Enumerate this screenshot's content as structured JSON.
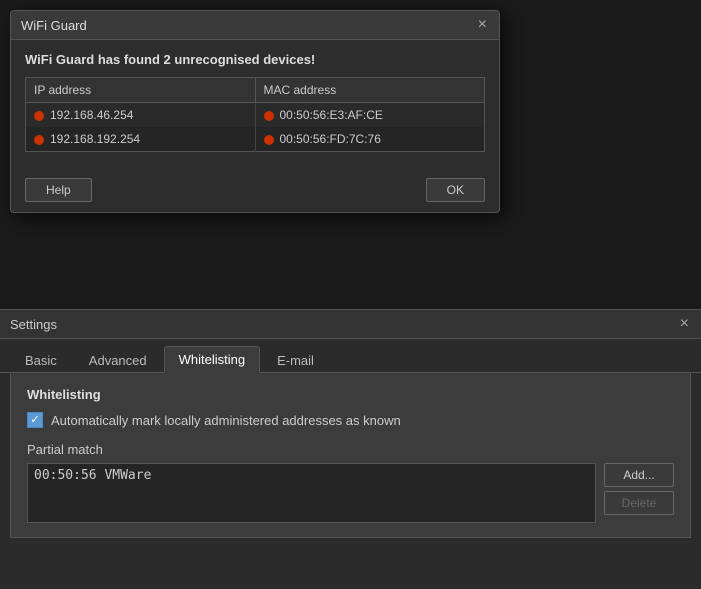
{
  "wifi_guard_dialog": {
    "title": "WiFi Guard",
    "warning": "WiFi Guard has found 2 unrecognised devices!",
    "close_label": "×",
    "table": {
      "col1_header": "IP address",
      "col2_header": "MAC address",
      "rows": [
        {
          "ip": "192.168.46.254",
          "mac": "00:50:56:E3:AF:CE"
        },
        {
          "ip": "192.168.192.254",
          "mac": "00:50:56:FD:7C:76"
        }
      ]
    },
    "help_btn": "Help",
    "ok_btn": "OK"
  },
  "settings_window": {
    "title": "Settings",
    "close_label": "×",
    "tabs": [
      {
        "label": "Basic",
        "active": false
      },
      {
        "label": "Advanced",
        "active": false
      },
      {
        "label": "Whitelisting",
        "active": true
      },
      {
        "label": "E-mail",
        "active": false
      }
    ],
    "whitelisting": {
      "section_title": "Whitelisting",
      "checkbox_label": "Automatically mark locally administered addresses as known",
      "checkbox_checked": true,
      "partial_match_label": "Partial match",
      "partial_match_value": "00:50:56 VMWare",
      "add_btn": "Add...",
      "delete_btn": "Delete"
    }
  }
}
